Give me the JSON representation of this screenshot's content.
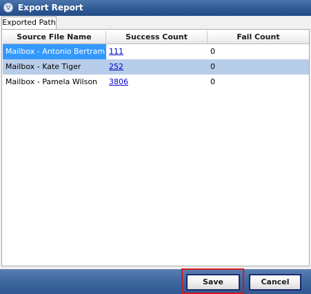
{
  "window": {
    "title": "Export Report",
    "icon": "app-logo-icon"
  },
  "tabs": [
    {
      "label": "Exported Path",
      "selected": true
    }
  ],
  "table": {
    "columns": [
      "Source File Name",
      "Success Count",
      "Fail Count"
    ],
    "rows": [
      {
        "source": "Mailbox - Antonio Bertram",
        "success": "111",
        "fail": "0",
        "selected": true
      },
      {
        "source": "Mailbox - Kate Tiger",
        "success": "252",
        "fail": "0",
        "selected": false
      },
      {
        "source": "Mailbox - Pamela Wilson",
        "success": "3806",
        "fail": "0",
        "selected": false
      }
    ]
  },
  "footer": {
    "save_label": "Save",
    "cancel_label": "Cancel"
  },
  "colors": {
    "titlebar": "#2f5a94",
    "selection": "#3399ff",
    "row_highlight": "#b8cde9",
    "footer": "#3e679f",
    "highlight_box": "#d8141e",
    "link": "#0000cc"
  }
}
